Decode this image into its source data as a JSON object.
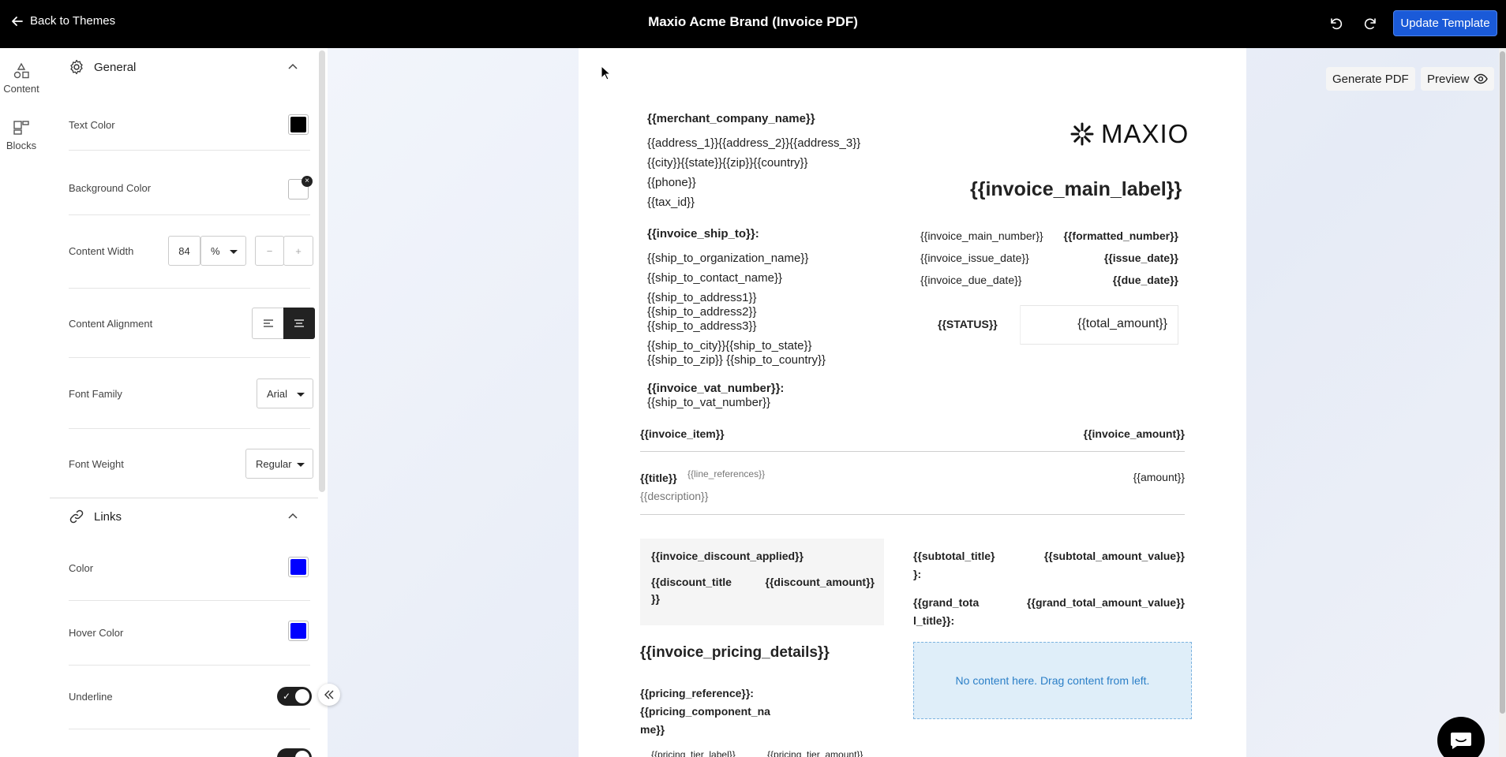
{
  "topbar": {
    "back_label": "Back to Themes",
    "title": "Maxio Acme Brand (Invoice PDF)",
    "update_label": "Update Template"
  },
  "rail": {
    "items": [
      {
        "label": "Content",
        "icon": "shapes-icon"
      },
      {
        "label": "Blocks",
        "icon": "blocks-icon"
      }
    ]
  },
  "panel": {
    "general": {
      "title": "General",
      "text_color_label": "Text Color",
      "text_color": "#000000",
      "background_color_label": "Background Color",
      "background_color": "#ffffff",
      "content_width_label": "Content Width",
      "content_width_value": "84",
      "content_width_unit": "%",
      "minus": "−",
      "plus": "+",
      "content_alignment_label": "Content Alignment",
      "font_family_label": "Font Family",
      "font_family_value": "Arial",
      "font_weight_label": "Font Weight",
      "font_weight_value": "Regular"
    },
    "links": {
      "title": "Links",
      "color_label": "Color",
      "color": "#0000ff",
      "hover_color_label": "Hover Color",
      "hover_color": "#0000ff",
      "underline_label": "Underline",
      "underline": true
    }
  },
  "canvas": {
    "generate_pdf_label": "Generate PDF",
    "preview_label": "Preview"
  },
  "invoice": {
    "merchant_company_name": "{{merchant_company_name}}",
    "address_line": "{{address_1}}{{address_2}}{{address_3}}",
    "city_line": "{{city}}{{state}}{{zip}}{{country}}",
    "phone": "{{phone}}",
    "tax_id": "{{tax_id}}",
    "logo_text": "MAXIO",
    "main_label": "{{invoice_main_label}}",
    "ship_to_label": "{{invoice_ship_to}}:",
    "ship_to_organization_name": "{{ship_to_organization_name}}",
    "ship_to_contact_name": "{{ship_to_contact_name}}",
    "ship_to_address1": "{{ship_to_address1}}",
    "ship_to_address2": "{{ship_to_address2}}",
    "ship_to_address3": "{{ship_to_address3}}",
    "ship_to_city_state": "{{ship_to_city}}{{ship_to_state}}",
    "ship_to_zip_country": "{{ship_to_zip}} {{ship_to_country}}",
    "vat_label": "{{invoice_vat_number}}:",
    "vat_value": "{{ship_to_vat_number}}",
    "meta": [
      {
        "label": "{{invoice_main_number}}",
        "value": "{{formatted_number}}"
      },
      {
        "label": "{{invoice_issue_date}}",
        "value": "{{issue_date}}"
      },
      {
        "label": "{{invoice_due_date}}",
        "value": "{{due_date}}"
      }
    ],
    "status": "{{STATUS}}",
    "total_amount": "{{total_amount}}",
    "item_header": "{{invoice_item}}",
    "amount_header": "{{invoice_amount}}",
    "line_title": "{{title}}",
    "line_references": "{{line_references}}",
    "line_description": "{{description}}",
    "line_amount": "{{amount}}",
    "discount_applied": "{{invoice_discount_applied}}",
    "discount_title_1": "{{discount_title",
    "discount_title_2": "}}",
    "discount_amount": "{{discount_amount}}",
    "subtotal_title_1": "{{subtotal_title}",
    "subtotal_title_2": "}:",
    "subtotal_amount_value": "{{subtotal_amount_value}}",
    "grand_total_title_1": "{{grand_tota",
    "grand_total_title_2": "l_title}}:",
    "grand_total_amount_value": "{{grand_total_amount_value}}",
    "pricing_details": "{{invoice_pricing_details}}",
    "pricing_reference": "{{pricing_reference}}:",
    "pricing_component_1": "{{pricing_component_na",
    "pricing_component_2": "me}}",
    "pricing_tier_label": "{{pricing_tier_label}}",
    "pricing_tier_amount": "{{pricing_tier_amount}}",
    "drop_zone_text": "No content here. Drag content from left."
  }
}
